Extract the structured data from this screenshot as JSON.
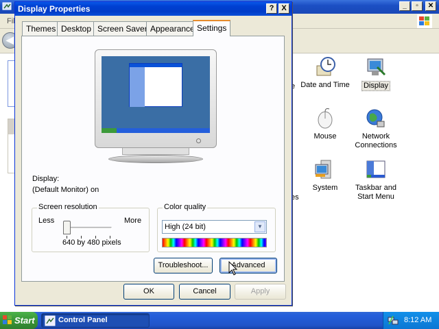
{
  "control_panel": {
    "menu_file_partial": "Fil",
    "items": [
      {
        "label": "Date and Time",
        "icon": "clock-icon"
      },
      {
        "label": "Display",
        "icon": "display-icon"
      },
      {
        "label": "Mouse",
        "icon": "mouse-icon"
      },
      {
        "label": "Network Connections",
        "line1": "Network",
        "line2": "Connections",
        "icon": "network-globe-icon"
      },
      {
        "label": "System",
        "icon": "system-icon"
      },
      {
        "label": "Taskbar and Start Menu",
        "line1": "Taskbar and",
        "line2": "Start Menu",
        "icon": "taskbar-icon"
      }
    ],
    "partial_labels": [
      "e",
      "es"
    ]
  },
  "dialog": {
    "title": "Display Properties",
    "help_button": "?",
    "close_button": "X",
    "tabs": [
      {
        "label": "Themes",
        "active": false
      },
      {
        "label": "Desktop",
        "active": false
      },
      {
        "label": "Screen Saver",
        "active": false
      },
      {
        "label": "Appearance",
        "active": false
      },
      {
        "label": "Settings",
        "active": true
      }
    ],
    "display_label": "Display:",
    "display_value": "(Default Monitor) on",
    "screen_resolution": {
      "legend": "Screen resolution",
      "less": "Less",
      "more": "More",
      "value": "640 by 480 pixels",
      "slider_position": 0
    },
    "color_quality": {
      "legend": "Color quality",
      "selected": "High (24 bit)"
    },
    "buttons": {
      "troubleshoot": "Troubleshoot...",
      "advanced": "Advanced",
      "ok": "OK",
      "cancel": "Cancel",
      "apply": "Apply"
    }
  },
  "taskbar": {
    "start": "Start",
    "task_control_panel": "Control Panel",
    "clock": "8:12 AM"
  },
  "colors": {
    "title_blue": "#0040d2",
    "face": "#ece9d8",
    "tab_accent": "#e68b2c",
    "start_green": "#3c9a3a"
  }
}
